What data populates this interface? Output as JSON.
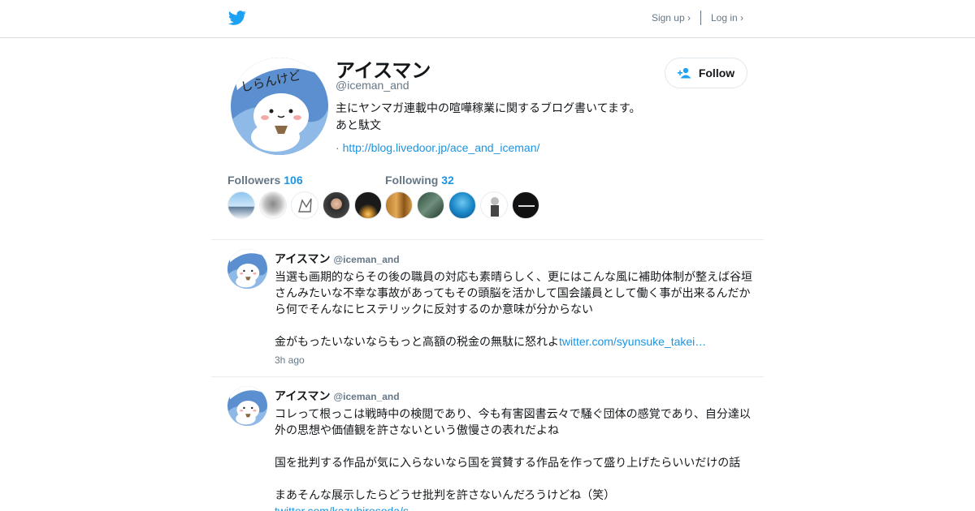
{
  "topnav": {
    "signup": "Sign up ›",
    "login": "Log in ›"
  },
  "profile": {
    "name": "アイスマン",
    "handle": "@iceman_and",
    "bio_line1": "主にヤンマガ連載中の喧嘩稼業に関するブログ書いてます。",
    "bio_line2": "あと駄文",
    "link_prefix": "·",
    "link": "http://blog.livedoor.jp/ace_and_iceman/",
    "follow_label": "Follow",
    "avatar_text": "しらんけど",
    "followers_label": "Followers",
    "followers_count": "106",
    "following_label": "Following",
    "following_count": "32"
  },
  "tweets": [
    {
      "name": "アイスマン",
      "handle": "@iceman_and",
      "p1": "当選も画期的ならその後の職員の対応も素晴らしく、更にはこんな風に補助体制が整えば谷垣さんみたいな不幸な事故があってもその頭脳を活かして国会議員として働く事が出来るんだから何でそんなにヒステリックに反対するのか意味が分からない",
      "p2": "金がもったいないならもっと高額の税金の無駄に怒れよ",
      "link": "twitter.com/syunsuke_takei…",
      "time": "3h ago"
    },
    {
      "name": "アイスマン",
      "handle": "@iceman_and",
      "p1": "コレって根っこは戦時中の検閲であり、今も有害図書云々で騒ぐ団体の感覚であり、自分達以外の思想や価値観を許さないという傲慢さの表れだよね",
      "p2": "国を批判する作品が気に入らないなら国を賞賛する作品を作って盛り上げたらいいだけの話",
      "p3": "まあそんな展示したらどうせ批判を許さないんだろうけどね（笑）",
      "link": "twitter.com/kazuhirosoda/s…"
    }
  ],
  "colors": {
    "brand": "#1da1f2",
    "link": "#1b95e0",
    "muted": "#657786",
    "border": "#e6ecf0"
  }
}
